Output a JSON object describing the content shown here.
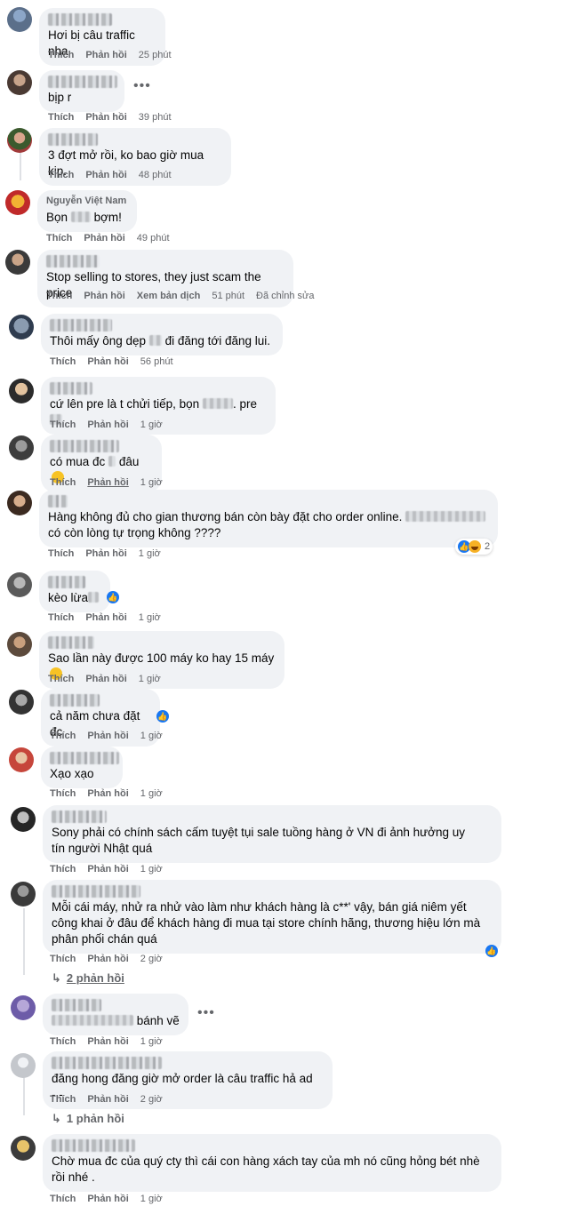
{
  "actions": {
    "like": "Thích",
    "reply": "Phản hồi",
    "see_translation": "Xem bản dịch",
    "edited": "Đã chỉnh sửa"
  },
  "comments": [
    {
      "author": "",
      "text": "Hơi bị câu traffic nha",
      "time": "25 phút"
    },
    {
      "author": "",
      "text": "bịp r",
      "time": "39 phút"
    },
    {
      "author": "",
      "text": "3 đợt mở rồi, ko bao giờ mua kịp.",
      "time": "48 phút"
    },
    {
      "author": "Nguyễn Việt Nam",
      "text": "Bọn",
      "text_after": "bợm!",
      "time": "49 phút"
    },
    {
      "author": "",
      "text": "Stop selling to stores, they just scam the price",
      "time": "51 phút"
    },
    {
      "author": "",
      "text": "Thôi mấy ông dẹp",
      "text_after": "đi đăng tới đăng lui.",
      "time": "56 phút"
    },
    {
      "author": "",
      "text": "cứ lên pre là t chửi tiếp, bọn",
      "text_after": ". pre",
      "time": "1 giờ"
    },
    {
      "author": "",
      "text": "có mua đc",
      "text_after": "đâu",
      "time": "1 giờ"
    },
    {
      "author": "",
      "text": "Hàng không đủ cho gian thương bán còn bày đặt cho order online.",
      "text2": "có còn lòng tự trọng không ????",
      "time": "1 giờ",
      "reactions": "2"
    },
    {
      "author": "",
      "text": "kèo lừa",
      "time": "1 giờ"
    },
    {
      "author": "",
      "text": "Sao lần này được 100 máy ko hay 15 máy",
      "time": "1 giờ"
    },
    {
      "author": "",
      "text": "cả năm chưa đặt đc",
      "time": "1 giờ"
    },
    {
      "author": "",
      "text": "Xạo xạo",
      "time": "1 giờ"
    },
    {
      "author": "",
      "text": "Sony phải có chính sách cấm tuyệt tụi sale tuồng hàng ở VN đi ảnh hưởng uy tín người Nhật quá",
      "time": "1 giờ"
    },
    {
      "author": "",
      "text": "Mỗi cái máy, nhử ra nhử vào làm như khách hàng là c**' vậy, bán giá niêm yết công khai ở đâu để khách hàng đi mua tại store chính hãng, thương hiệu lớn mà phân phối chán quá",
      "time": "2 giờ",
      "replies": "2 phản hồi"
    },
    {
      "author": "",
      "text": "bánh vẽ",
      "time": "1 giờ"
    },
    {
      "author": "",
      "text": "đăng hong đăng giờ mở order là câu traffic hả ad -.-",
      "time": "2 giờ",
      "replies": "1 phản hồi"
    },
    {
      "author": "",
      "text": "Chờ mua đc của quý cty thì cái con hàng xách tay của mh nó cũng hỏng bét nhè rồi nhé .",
      "time": "1 giờ"
    }
  ]
}
